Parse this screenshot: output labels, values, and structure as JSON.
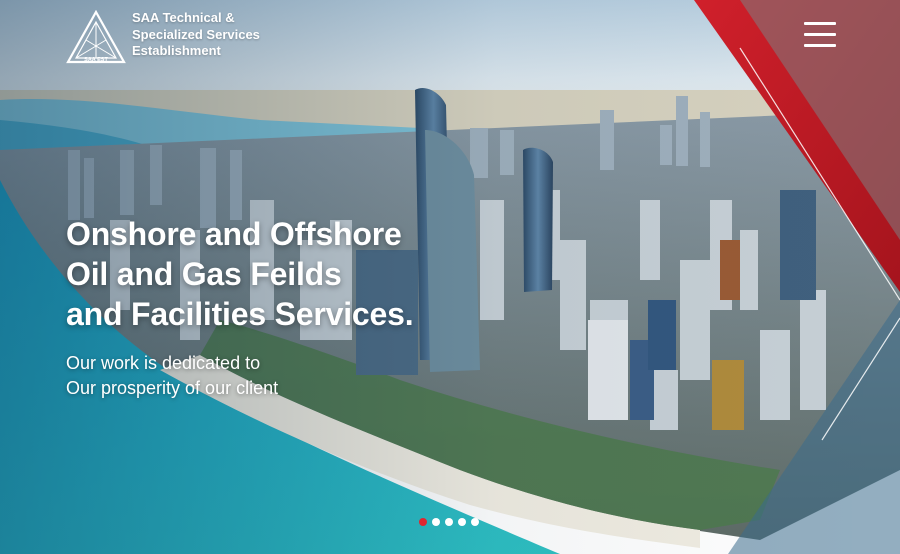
{
  "header": {
    "company_name_lines": [
      "SAA Technical &",
      "Specialized Services",
      "Establishment"
    ],
    "logo_text": "SAA EST",
    "menu_icon": "hamburger-menu-icon"
  },
  "hero": {
    "headline_lines": [
      "Onshore and Offshore",
      "Oil and Gas Feilds",
      "and Facilities Services."
    ],
    "sub_lines": [
      "Our work is dedicated to",
      "Our prosperity of our client"
    ]
  },
  "slider": {
    "count": 5,
    "active_index": 0
  },
  "colors": {
    "accent_red": "#c8202a",
    "text": "#ffffff",
    "sea": "#1aa0c4",
    "sky": "#cfe1ee"
  }
}
